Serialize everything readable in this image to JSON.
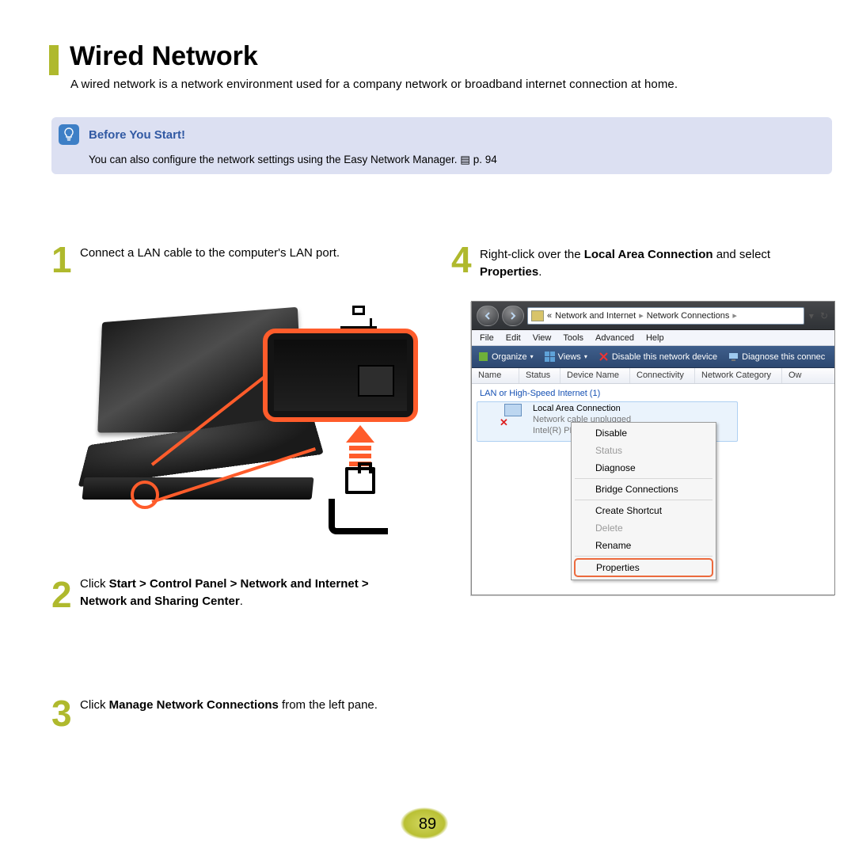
{
  "page": {
    "title": "Wired Network",
    "subtitle": "A wired network is a network environment used for a company network or broadband internet connection at home.",
    "number": "89"
  },
  "before": {
    "title": "Before You Start!",
    "body_prefix": "You can also configure the network settings using the Easy Network Manager. ",
    "page_ref": "▤ p. 94"
  },
  "steps": {
    "n1": "1",
    "t1": "Connect a LAN cable to the computer's LAN port.",
    "n2": "2",
    "t2_a": "Click ",
    "t2_b": "Start > Control Panel > Network and Internet > Network and Sharing Center",
    "t2_c": ".",
    "n3": "3",
    "t3_a": "Click ",
    "t3_b": "Manage Network Connections",
    "t3_c": " from the left pane.",
    "n4": "4",
    "t4_a": "Right-click over the ",
    "t4_b": "Local Area Connection",
    "t4_c": " and select ",
    "t4_d": "Properties",
    "t4_e": "."
  },
  "win": {
    "address_prefix": "«",
    "crumb1": "Network and Internet",
    "crumb2": "Network Connections",
    "menus": {
      "file": "File",
      "edit": "Edit",
      "view": "View",
      "tools": "Tools",
      "adv": "Advanced",
      "help": "Help"
    },
    "toolbar": {
      "organize": "Organize",
      "views": "Views",
      "disable": "Disable this network device",
      "diagnose": "Diagnose this connec"
    },
    "cols": {
      "name": "Name",
      "status": "Status",
      "devname": "Device Name",
      "conn": "Connectivity",
      "netcat": "Network Category",
      "ow": "Ow"
    },
    "group": "LAN or High-Speed Internet (1)",
    "conn": {
      "l1": "Local Area Connection",
      "l2": "Network cable unplugged",
      "l3": "Intel(R) PRO/1000"
    },
    "ctx": {
      "disable": "Disable",
      "status": "Status",
      "diagnose": "Diagnose",
      "bridge": "Bridge Connections",
      "shortcut": "Create Shortcut",
      "delete": "Delete",
      "rename": "Rename",
      "properties": "Properties"
    }
  }
}
